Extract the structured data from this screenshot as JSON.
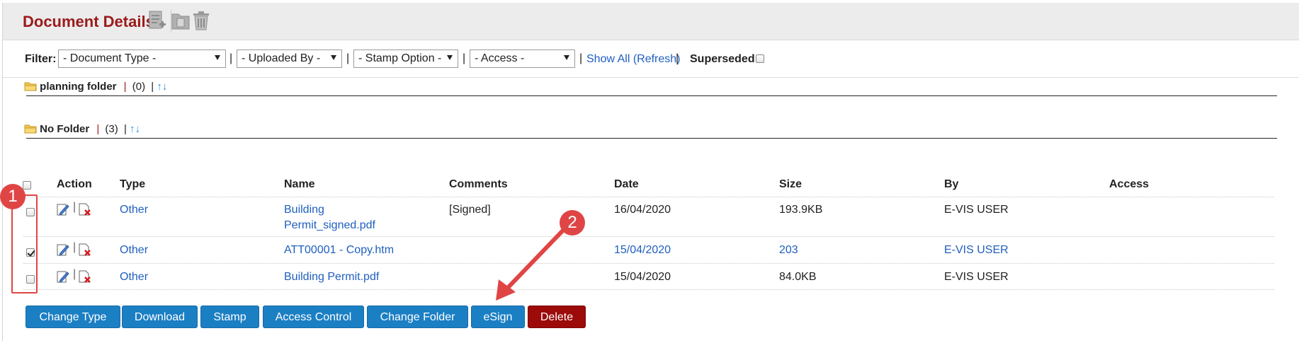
{
  "header": {
    "title": "Document Details"
  },
  "filter": {
    "label": "Filter:",
    "selects": [
      "- Document Type -",
      "- Uploaded By -",
      "- Stamp Option -",
      "- Access -"
    ],
    "pipe": "|",
    "show_all": "Show All (Refresh)",
    "superseded_label": "Superseded"
  },
  "folders": [
    {
      "name": "planning folder",
      "count": "(0)",
      "pipe": "|",
      "sort": "↑↓"
    },
    {
      "name": "No Folder",
      "count": "(3)",
      "pipe": "|",
      "sort": "↑↓"
    }
  ],
  "table": {
    "headers": [
      "Action",
      "Type",
      "Name",
      "Comments",
      "Date",
      "Size",
      "By",
      "Access"
    ],
    "rows": [
      {
        "checked": false,
        "type": "Other",
        "name_line1": "Building",
        "name_line2": "Permit_signed.pdf",
        "comments": "[Signed]",
        "date": "16/04/2020",
        "size": "193.9KB",
        "by": "E-VIS USER",
        "access": ""
      },
      {
        "checked": true,
        "type": "Other",
        "name_line1": "ATT00001 - Copy.htm",
        "name_line2": "",
        "comments": "",
        "date": "15/04/2020",
        "size": "203",
        "by": "E-VIS USER",
        "access": ""
      },
      {
        "checked": false,
        "type": "Other",
        "name_line1": "Building Permit.pdf",
        "name_line2": "",
        "comments": "",
        "date": "15/04/2020",
        "size": "84.0KB",
        "by": "E-VIS USER",
        "access": ""
      }
    ]
  },
  "buttons": [
    "Change Type",
    "Download",
    "Stamp",
    "Access Control",
    "Change Folder",
    "eSign",
    "Delete"
  ],
  "annotations": {
    "one": "1",
    "two": "2"
  },
  "colors": {
    "title": "#9b1b1b",
    "button": "#1b7fc4",
    "delete": "#9c0a0a",
    "link": "#1f5fbf",
    "annotation": "#e04545"
  }
}
